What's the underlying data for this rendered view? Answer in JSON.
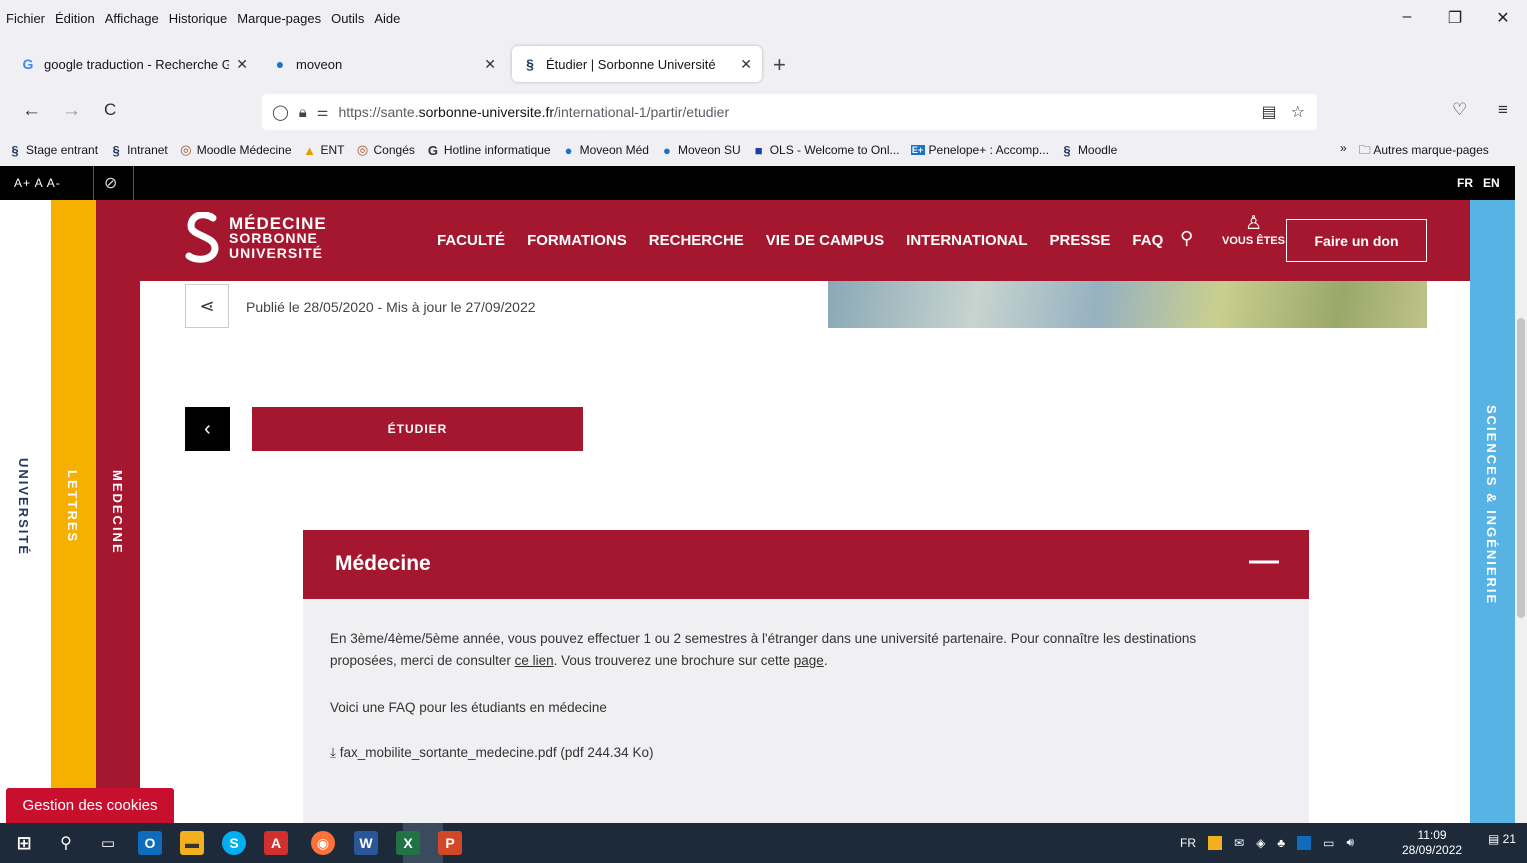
{
  "menubar": {
    "items": [
      "Fichier",
      "Édition",
      "Affichage",
      "Historique",
      "Marque-pages",
      "Outils",
      "Aide"
    ],
    "controls": {
      "minimize": "–",
      "restore": "❐",
      "close": "✕"
    }
  },
  "tabs": [
    {
      "title": "google traduction - Recherche G",
      "favicon": "G",
      "close": "✕"
    },
    {
      "title": "moveon",
      "favicon": "●",
      "close": "✕"
    },
    {
      "title": "Étudier | Sorbonne Université",
      "favicon": "§",
      "close": "✕"
    }
  ],
  "newtab": "+",
  "navbar": {
    "back": "←",
    "forward": "→",
    "reload": "C",
    "url_prefix": "https://sante.",
    "url_domain": "sorbonne-universite.fr",
    "url_path": "/international-1/partir/etudier"
  },
  "bookmarks": [
    {
      "icon": "§",
      "label": "Stage entrant"
    },
    {
      "icon": "§",
      "label": "Intranet"
    },
    {
      "icon": "◎",
      "label": "Moodle Médecine"
    },
    {
      "icon": "▲",
      "label": "ENT"
    },
    {
      "icon": "◎",
      "label": "Congés"
    },
    {
      "icon": "G",
      "label": "Hotline informatique"
    },
    {
      "icon": "●",
      "label": "Moveon Méd"
    },
    {
      "icon": "●",
      "label": "Moveon SU"
    },
    {
      "icon": "■",
      "label": "OLS - Welcome to Onl..."
    },
    {
      "icon": "E+",
      "label": "Penelope+ : Accomp..."
    },
    {
      "icon": "§",
      "label": "Moodle"
    }
  ],
  "bookmarks_more": {
    "chevron": "»",
    "folder": "Autres marque-pages"
  },
  "access_bar": {
    "sizes": "A+ A A-",
    "langs": [
      "FR",
      "EN"
    ]
  },
  "side_strips": {
    "universite": "UNIVERSITÉ",
    "lettres": "LETTRES",
    "medecine": "MEDECINE",
    "sciences": "SCIENCES & INGÉNIERIE"
  },
  "header": {
    "logo": [
      "MÉDECINE",
      "SORBONNE",
      "UNIVERSITÉ"
    ],
    "nav": [
      "FACULTÉ",
      "FORMATIONS",
      "RECHERCHE",
      "VIE DE CAMPUS",
      "INTERNATIONAL",
      "PRESSE",
      "FAQ"
    ],
    "vous_etes": "VOUS ÊTES",
    "don": "Faire un don"
  },
  "article": {
    "pubdate": "Publié le 28/05/2020 - Mis à jour le 27/09/2022",
    "section_button": "ÉTUDIER"
  },
  "accordion": {
    "title": "Médecine",
    "toggle": "—",
    "p1_a": "En 3ème/4ème/5ème année, vous pouvez effectuer 1 ou 2 semestres à l'étranger dans une université partenaire.  Pour connaître les destinations proposées, merci de consulter ",
    "p1_link1": "ce lien",
    "p1_b": ".  Vous trouverez  une brochure sur cette ",
    "p1_link2": "page",
    "p1_c": ".",
    "p2": "Voici une FAQ pour les étudiants en médecine",
    "file": "fax_mobilite_sortante_medecine.pdf",
    "file_meta": "(pdf 244.34 Ko)"
  },
  "cookie_button": "Gestion des cookies",
  "taskbar": {
    "lang": "FR",
    "time": "11:09",
    "date": "28/09/2022",
    "notifications": "21"
  }
}
